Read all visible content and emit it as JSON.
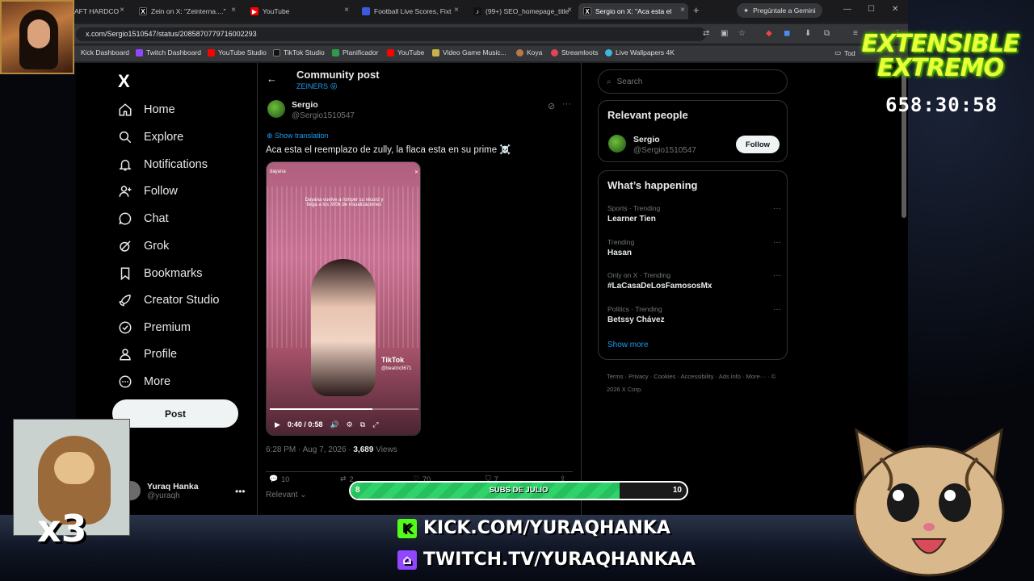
{
  "browser": {
    "tabs": [
      {
        "label": "AFT HARDCO",
        "color": "#e44d26"
      },
      {
        "label": "Zein on X: \"Zeinterna....\"",
        "color": "#000000"
      },
      {
        "label": "YouTube",
        "color": "#ff0000"
      },
      {
        "label": "Football Live Scores, Fixt",
        "color": "#3b5bdb"
      },
      {
        "label": "(99+) SEO_homepage_title",
        "color": "#000000"
      },
      {
        "label": "Sergio on X: \"Aca esta el",
        "color": "#000000"
      }
    ],
    "gemini_label": "Pregúntale a Gemini",
    "url": "x.com/Sergio1510547/status/2085870779716002293",
    "bookmarks": [
      "Kick Dashboard",
      "Twitch Dashboard",
      "YouTube Studio",
      "TikTok Studio",
      "Planificador",
      "YouTube",
      "Video Game Music...",
      "Koya",
      "Streamloots",
      "Live Wallpapers 4K"
    ],
    "bookmarks_folder": "Tod"
  },
  "nav": {
    "logo": "X",
    "items": [
      "Home",
      "Explore",
      "Notifications",
      "Follow",
      "Chat",
      "Grok",
      "Bookmarks",
      "Creator Studio",
      "Premium",
      "Profile",
      "More"
    ],
    "post_label": "Post",
    "account_name": "Yuraq Hanka",
    "account_handle": "@yuraqh"
  },
  "post": {
    "header_title": "Community post",
    "header_sub": "ZEINERS 😝",
    "author_name": "Sergio",
    "author_handle": "@Sergio1510547",
    "show_translation": "Show translation",
    "text": "Aca esta el reemplazo de zully, la flaca esta en su prime ☠️",
    "meta_time": "6:28 PM · Aug 7, 2026 · ",
    "meta_views": "3,689",
    "meta_views_label": " Views",
    "video": {
      "time": "0:40 / 0:58",
      "progress": 0.69,
      "overlay_user": "dayana",
      "overlay_caption": "Dayana vuelve a romper su récord y llega a los 300k de visualizaciones",
      "watermark": "TikTok",
      "watermark_handle": "@beatrix3671"
    },
    "actions": {
      "replies": "10",
      "reposts": "2",
      "likes": "70",
      "bookmarks": "7"
    },
    "relevant_label": "Relevant"
  },
  "sidebar": {
    "search_placeholder": "Search",
    "relevant_title": "Relevant people",
    "rp_name": "Sergio",
    "rp_handle": "@Sergio1510547",
    "follow_label": "Follow",
    "happening_title": "What’s happening",
    "trends": [
      {
        "context": "Sports · Trending",
        "name": "Learner Tien"
      },
      {
        "context": "Trending",
        "name": "Hasan"
      },
      {
        "context": "Only on X · Trending",
        "name": "#LaCasaDeLosFamososMx"
      },
      {
        "context": "Politics · Trending",
        "name": "Betssy Chávez"
      }
    ],
    "show_more": "Show more",
    "footer": "Terms · Privacy · Cookies · Accessibility · Ads info · More··· · © 2026 X Corp."
  },
  "stream": {
    "title_line1": "EXTENSIBLE",
    "title_line2": "EXTREMO",
    "timer": "658:30:58",
    "multiplier": "x3",
    "subs_label": "SUBS DE JULIO",
    "subs_current": "8",
    "subs_goal": "10",
    "subs_progress": 0.8,
    "kick": "KICK.COM/YURAQHANKA",
    "twitch": "TWITCH.TV/YURAQHANKAA"
  }
}
